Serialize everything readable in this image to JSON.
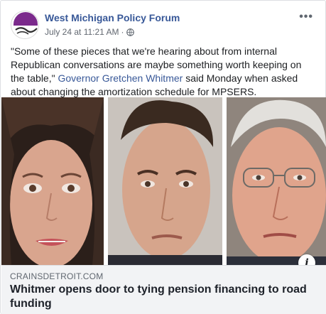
{
  "post": {
    "page_name": "West Michigan Policy Forum",
    "timestamp": "July 24 at 11:21 AM",
    "separator": "·",
    "more_label": "•••",
    "text_before": "\"Some of these pieces that we're hearing about from internal Republican conversations are maybe something worth keeping on the table,\" ",
    "mention": "Governor Gretchen Whitmer",
    "text_after": " said Monday when asked about changing the amortization schedule for MPSERS."
  },
  "link": {
    "domain": "CRAINSDETROIT.COM",
    "title": "Whitmer opens door to tying pension financing to road funding",
    "info_label": "i"
  },
  "colors": {
    "page_name": "#385898",
    "avatar_accent": "#7b2a8c",
    "link_bg": "#f2f3f5"
  },
  "icons": {
    "avatar": "west-michigan-logo",
    "privacy": "globe-icon",
    "menu": "more-options-icon",
    "info": "info-icon"
  }
}
